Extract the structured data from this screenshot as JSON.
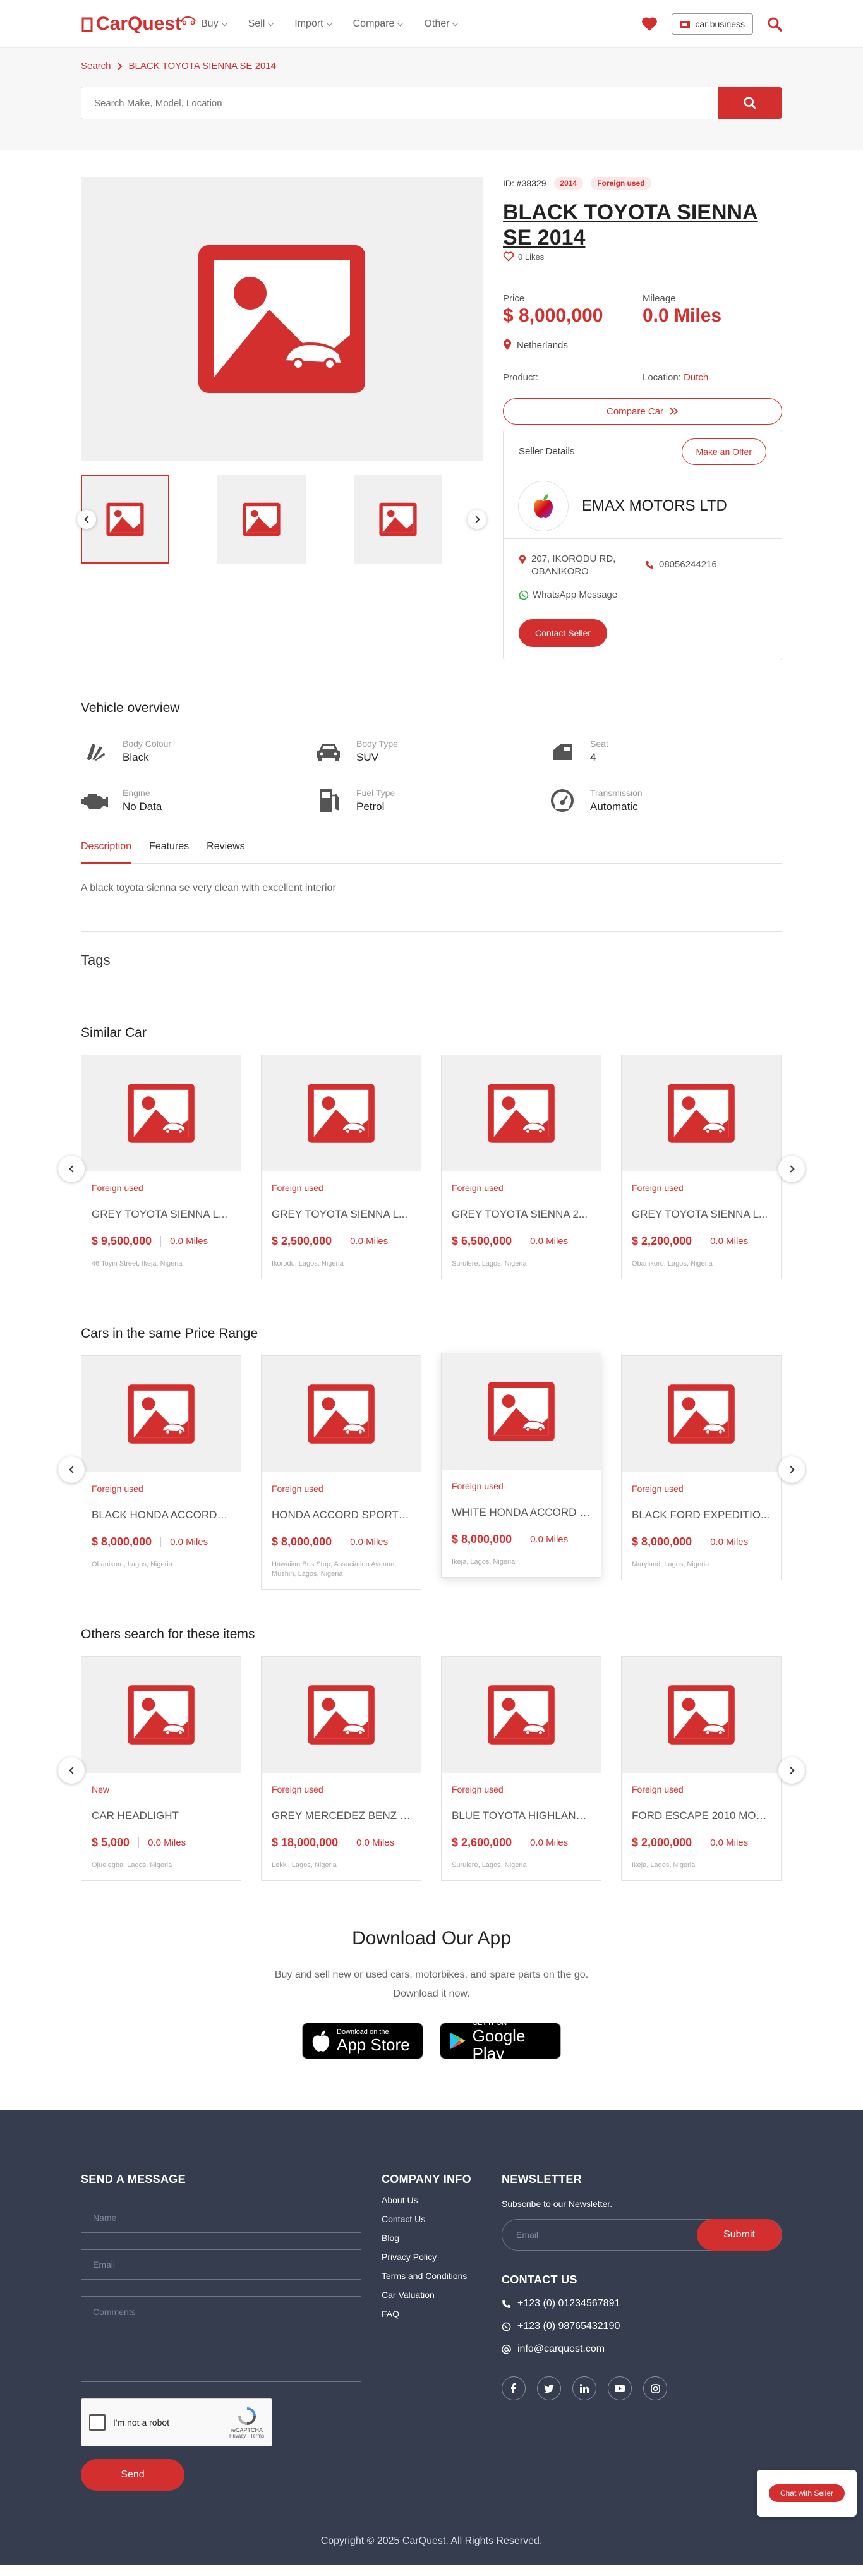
{
  "header": {
    "logo": "CarQuest",
    "nav": [
      "Buy",
      "Sell",
      "Import",
      "Compare",
      "Other"
    ],
    "business_button": "car business"
  },
  "search": {
    "breadcrumb_root": "Search",
    "breadcrumb_current": "BLACK TOYOTA SIENNA SE 2014",
    "placeholder": "Search Make, Model, Location"
  },
  "product": {
    "id": "ID: #38329",
    "year_badge": "2014",
    "condition_badge": "Foreign used",
    "title": "BLACK TOYOTA SIENNA SE 2014",
    "likes": "0 Likes",
    "price_label": "Price",
    "price": "$ 8,000,000",
    "mileage_label": "Mileage",
    "mileage": "0.0 Miles",
    "country": "Netherlands",
    "product_label": "Product:",
    "location_label": "Location:",
    "location_value": "Dutch",
    "compare_label": "Compare Car"
  },
  "seller": {
    "heading": "Seller Details",
    "offer_label": "Make an Offer",
    "name": "EMAX MOTORS LTD",
    "address": "207, IKORODU RD, OBANIKORO",
    "phone": "08056244216",
    "whatsapp": "WhatsApp Message",
    "contact_label": "Contact Seller"
  },
  "overview": {
    "title": "Vehicle overview",
    "items": [
      {
        "label": "Body Colour",
        "value": "Black",
        "icon": "paint-palette-icon"
      },
      {
        "label": "Body Type",
        "value": "SUV",
        "icon": "car-front-icon"
      },
      {
        "label": "Seat",
        "value": "4",
        "icon": "seat-icon"
      },
      {
        "label": "Engine",
        "value": "No Data",
        "icon": "engine-icon"
      },
      {
        "label": "Fuel Type",
        "value": "Petrol",
        "icon": "fuel-pump-icon"
      },
      {
        "label": "Transmission",
        "value": "Automatic",
        "icon": "speedometer-icon"
      }
    ]
  },
  "tabs": [
    "Description",
    "Features",
    "Reviews"
  ],
  "description": "A black toyota sienna se very clean with excellent interior",
  "tags_title": "Tags",
  "sections": [
    {
      "title": "Similar Car",
      "cards": [
        {
          "tag": "Foreign used",
          "name": "GREY TOYOTA SIENNA L...",
          "price": "$ 9,500,000",
          "miles": "0.0 Miles",
          "loc": "46 Toyin Street, Ikeja, Nigeria"
        },
        {
          "tag": "Foreign used",
          "name": "GREY TOYOTA SIENNA L...",
          "price": "$ 2,500,000",
          "miles": "0.0 Miles",
          "loc": "Ikorodu, Lagos, Nigeria"
        },
        {
          "tag": "Foreign used",
          "name": "GREY TOYOTA SIENNA 2...",
          "price": "$ 6,500,000",
          "miles": "0.0 Miles",
          "loc": "Surulere, Lagos, Nigeria"
        },
        {
          "tag": "Foreign used",
          "name": "GREY TOYOTA SIENNA L...",
          "price": "$ 2,200,000",
          "miles": "0.0 Miles",
          "loc": "Obanikoro, Lagos, Nigeria"
        }
      ]
    },
    {
      "title": "Cars in the same Price Range",
      "cards": [
        {
          "tag": "Foreign used",
          "name": "BLACK HONDA ACCORD 2...",
          "price": "$ 8,000,000",
          "miles": "0.0 Miles",
          "loc": "Obanikoro, Lagos, Nigeria"
        },
        {
          "tag": "Foreign used",
          "name": "HONDA ACCORD SPORT 2...",
          "price": "$ 8,000,000",
          "miles": "0.0 Miles",
          "loc": "Hawaiian Bus Stop, Association Avenue, Mushin, Lagos, Nigeria"
        },
        {
          "tag": "Foreign used",
          "name": "WHITE HONDA ACCORD 2...",
          "price": "$ 8,000,000",
          "miles": "0.0 Miles",
          "loc": "Ikeja, Lagos, Nigeria"
        },
        {
          "tag": "Foreign used",
          "name": "BLACK FORD EXPEDITIO...",
          "price": "$ 8,000,000",
          "miles": "0.0 Miles",
          "loc": "Maryland, Lagos, Nigeria"
        }
      ]
    },
    {
      "title": "Others search for these items",
      "cards": [
        {
          "tag": "New",
          "name": "CAR HEADLIGHT",
          "price": "$ 5,000",
          "miles": "0.0 Miles",
          "loc": "Ojuelegba, Lagos, Nigeria"
        },
        {
          "tag": "Foreign used",
          "name": "GREY MERCEDEZ BENZ E...",
          "price": "$ 18,000,000",
          "miles": "0.0 Miles",
          "loc": "Lekki, Lagos, Nigeria"
        },
        {
          "tag": "Foreign used",
          "name": "BLUE TOYOTA HIGHLAND...",
          "price": "$ 2,600,000",
          "miles": "0.0 Miles",
          "loc": "Surulere, Lagos, Nigeria"
        },
        {
          "tag": "Foreign used",
          "name": "FORD ESCAPE 2010 MOD...",
          "price": "$ 2,000,000",
          "miles": "0.0 Miles",
          "loc": "Ikeja, Lagos, Nigeria"
        }
      ]
    }
  ],
  "app": {
    "title": "Download Our App",
    "line1": "Buy and sell new or used cars, motorbikes, and spare parts on the go.",
    "line2": "Download it now.",
    "appstore_small": "Download on the",
    "appstore_big": "App Store",
    "play_small": "GET IT ON",
    "play_big": "Google Play"
  },
  "footer": {
    "message_title": "SEND A MESSAGE",
    "name_ph": "Name",
    "email_ph": "Email",
    "comments_ph": "Comments",
    "captcha": "I'm not a robot",
    "captcha_brand": "reCAPTCHA",
    "captcha_links": "Privacy - Terms",
    "send": "Send",
    "company_title": "COMPANY INFO",
    "links": [
      "About Us",
      "Contact Us",
      "Blog",
      "Privacy Policy",
      "Terms and Conditions",
      "Car Valuation",
      "FAQ"
    ],
    "news_title": "NEWSLETTER",
    "news_sub": "Subscribe to our Newsletter.",
    "news_ph": "Email",
    "news_btn": "Submit",
    "contact_title": "CONTACT US",
    "phone1": "+123 (0) 01234567891",
    "phone2": "+123 (0) 98765432190",
    "email": "info@carquest.com",
    "copyright": "Copyright © 2025 CarQuest. All Rights Reserved.",
    "chat": "Chat with Seller"
  },
  "colors": {
    "accent": "#d32f2f",
    "footer_bg": "#353d4f"
  }
}
